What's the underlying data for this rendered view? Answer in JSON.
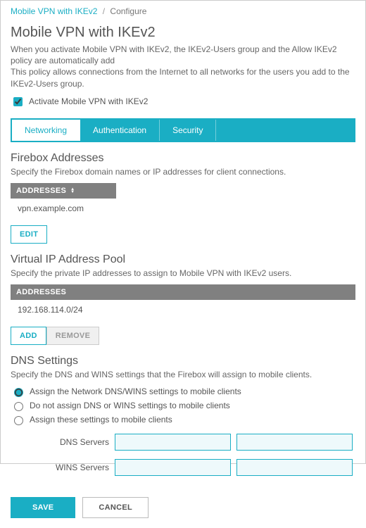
{
  "breadcrumb": {
    "link": "Mobile VPN with IKEv2",
    "current": "Configure"
  },
  "header": {
    "title": "Mobile VPN with IKEv2",
    "desc1": "When you activate Mobile VPN with IKEv2, the IKEv2-Users group and the Allow IKEv2 policy are automatically add",
    "desc2": "This policy allows connections from the Internet to all networks for the users you add to the IKEv2-Users group.",
    "activate_label": "Activate Mobile VPN with IKEv2"
  },
  "tabs": {
    "networking": "Networking",
    "authentication": "Authentication",
    "security": "Security"
  },
  "firebox": {
    "heading": "Firebox Addresses",
    "desc": "Specify the Firebox domain names or IP addresses for client connections.",
    "col": "ADDRESSES",
    "value": "vpn.example.com",
    "edit": "EDIT"
  },
  "vip": {
    "heading": "Virtual IP Address Pool",
    "desc": "Specify the private IP addresses to assign to Mobile VPN with IKEv2 users.",
    "col": "ADDRESSES",
    "value": "192.168.114.0/24",
    "add": "ADD",
    "remove": "REMOVE"
  },
  "dns": {
    "heading": "DNS Settings",
    "desc": "Specify the DNS and WINS settings that the Firebox will assign to mobile clients.",
    "opt1": "Assign the Network DNS/WINS settings to mobile clients",
    "opt2": "Do not assign DNS or WINS settings to mobile clients",
    "opt3": "Assign these settings to mobile clients",
    "dns_label": "DNS Servers",
    "wins_label": "WINS Servers"
  },
  "footer": {
    "save": "SAVE",
    "cancel": "CANCEL"
  }
}
